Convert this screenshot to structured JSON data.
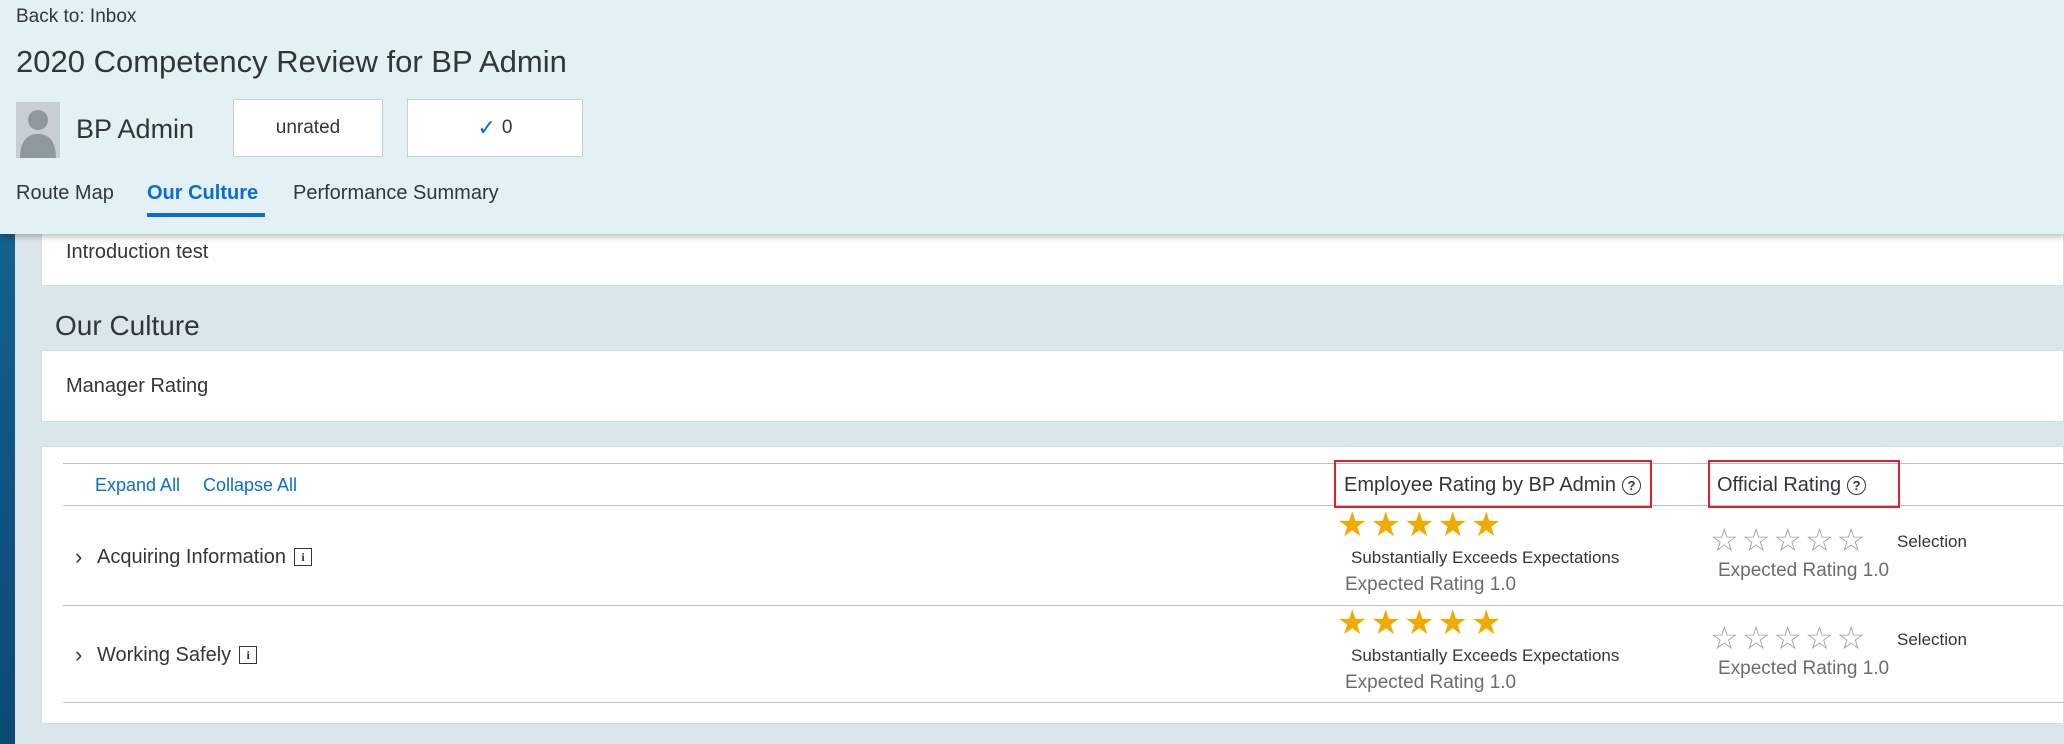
{
  "header": {
    "back_link": "Back to: Inbox",
    "title": "2020 Competency Review for BP Admin",
    "user_name": "BP Admin",
    "rating_button": "unrated",
    "check_count": "0",
    "tabs": [
      {
        "label": "Route Map"
      },
      {
        "label": "Our Culture"
      },
      {
        "label": "Performance Summary"
      }
    ],
    "active_tab": "Our Culture"
  },
  "intro": {
    "text": "Introduction test"
  },
  "section": {
    "title": "Our Culture",
    "manager_rating": "Manager Rating"
  },
  "table": {
    "expand_all": "Expand All",
    "collapse_all": "Collapse All",
    "col_employee": "Employee Rating by BP Admin",
    "col_official": "Official Rating",
    "rows": [
      {
        "name": "Acquiring Information",
        "employee_stars": 5,
        "employee_label": "Substantially Exceeds Expectations",
        "employee_expected": "Expected Rating 1.0",
        "official_stars": 0,
        "official_label": "Selection",
        "official_expected": "Expected Rating 1.0"
      },
      {
        "name": "Working Safely",
        "employee_stars": 5,
        "employee_label": "Substantially Exceeds Expectations",
        "employee_expected": "Expected Rating 1.0",
        "official_stars": 0,
        "official_label": "Selection",
        "official_expected": "Expected Rating 1.0"
      }
    ]
  },
  "colors": {
    "accent": "#0a6ed1",
    "star": "#f0ab00",
    "highlight_box": "#e0202a",
    "header_bg": "#e3f1f4"
  }
}
